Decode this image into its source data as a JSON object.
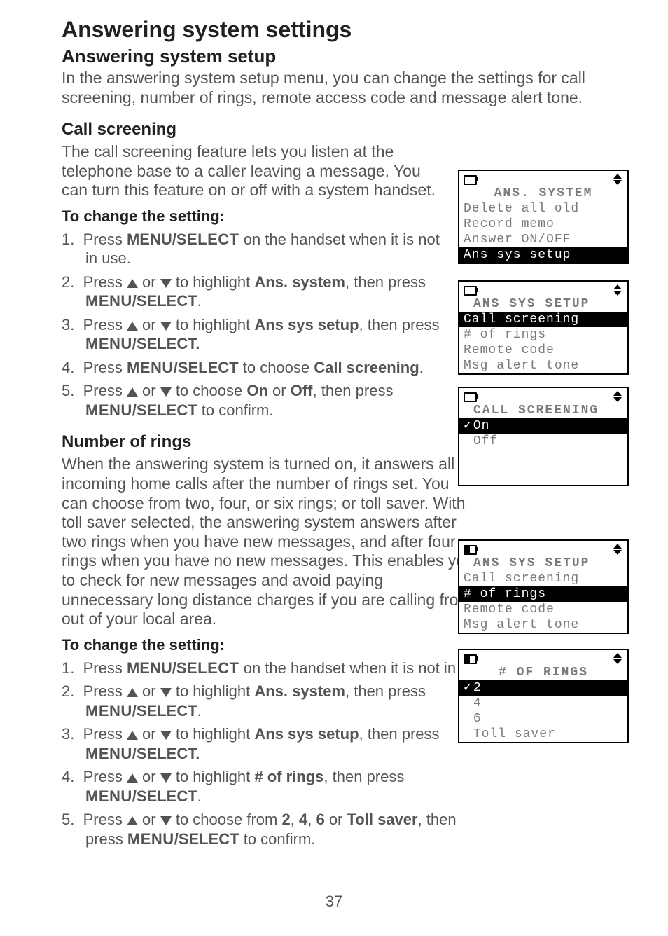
{
  "page": {
    "title": "Answering system settings",
    "number": "37"
  },
  "setup": {
    "heading": "Answering system setup",
    "intro": "In the answering system setup menu, you can change the settings for call screening, number of rings, remote access code and message alert tone."
  },
  "callScreening": {
    "heading": "Call screening",
    "body": "The call screening feature lets you listen at the telephone base to a caller leaving a message. You can turn this feature on or off with a system handset.",
    "changeHeading": "To change the setting:",
    "steps": {
      "s1a": "Press ",
      "s1b": "MENU/",
      "s1c": "SELECT",
      "s1d": " on the handset when it is not in use.",
      "s2a": "Press ",
      "s2b": " or ",
      "s2c": " to highlight ",
      "s2d": "Ans. system",
      "s2e": ", then press ",
      "s2f": "MENU",
      "s2g": "/SELECT",
      "s2h": ".",
      "s3a": "Press ",
      "s3b": " or ",
      "s3c": " to highlight ",
      "s3d": "Ans sys setup",
      "s3e": ", then press ",
      "s3f": "MENU",
      "s3g": "/SELECT.",
      "s4a": "Press ",
      "s4b": "MENU",
      "s4c": "/SELECT",
      "s4d": " to choose ",
      "s4e": "Call screening",
      "s4f": ".",
      "s5a": "Press ",
      "s5b": " or ",
      "s5c": " to choose ",
      "s5d": "On",
      "s5e": " or ",
      "s5f": "Off",
      "s5g": ", then press ",
      "s5h": "MENU",
      "s5i": "/SELECT",
      "s5j": " to confirm."
    }
  },
  "numRings": {
    "heading": "Number of rings",
    "body": "When the answering system is turned on, it answers all incoming home calls after the number of rings set. You can choose from two, four, or six rings; or toll saver. With toll saver selected, the answering system answers after two rings when you have new messages, and after four rings when you have no new messages. This enables you to check for new messages and avoid paying unnecessary long distance charges if you are calling from out of your local area.",
    "changeHeading": "To change the setting:",
    "steps": {
      "s1a": "Press ",
      "s1b": "MENU/",
      "s1c": "SELECT",
      "s1d": " on the handset when it is not in use.",
      "s2a": "Press ",
      "s2b": " or ",
      "s2c": " to highlight ",
      "s2d": "Ans. system",
      "s2e": ", then press ",
      "s2f": "MENU",
      "s2g": "/SELECT",
      "s2h": ".",
      "s3a": "Press ",
      "s3b": " or ",
      "s3c": " to highlight ",
      "s3d": "Ans sys setup",
      "s3e": ", then press ",
      "s3f": "MENU",
      "s3g": "/SELECT.",
      "s4a": "Press  ",
      "s4b": " or ",
      "s4c": " to highlight ",
      "s4d": "# of rings",
      "s4e": ", then press ",
      "s4f": "MENU",
      "s4g": "/SELECT",
      "s4h": ".",
      "s5a": "Press ",
      "s5b": " or ",
      "s5c": " to choose from ",
      "s5d": "2",
      "s5e": ", ",
      "s5f": "4",
      "s5g": ", ",
      "s5h": "6",
      "s5i": " or ",
      "s5j": "Toll saver",
      "s5k": ", then press ",
      "s5l": "MENU",
      "s5m": "/SELECT",
      "s5n": " to confirm."
    }
  },
  "screens": {
    "ansSystem": {
      "title": "ANS. SYSTEM",
      "rows": [
        "Delete all old",
        "Record memo",
        "Answer ON/OFF",
        "Ans sys setup"
      ],
      "selected": 3
    },
    "ansSysSetup1": {
      "title": "ANS SYS SETUP",
      "rows": [
        "Call screening",
        "# of rings",
        "Remote code",
        "Msg alert tone"
      ],
      "selected": 0
    },
    "callScreening": {
      "title": "CALL SCREENING",
      "rows": [
        "On",
        "Off"
      ],
      "checked": 0,
      "selected": 0
    },
    "ansSysSetup2": {
      "title": "ANS SYS SETUP",
      "rows": [
        "Call screening",
        "# of rings",
        "Remote code",
        "Msg alert tone"
      ],
      "selected": 1
    },
    "numOfRings": {
      "title": "# OF RINGS",
      "rows": [
        "2",
        "4",
        "6",
        "Toll saver"
      ],
      "checked": 0,
      "selected": 0
    }
  }
}
